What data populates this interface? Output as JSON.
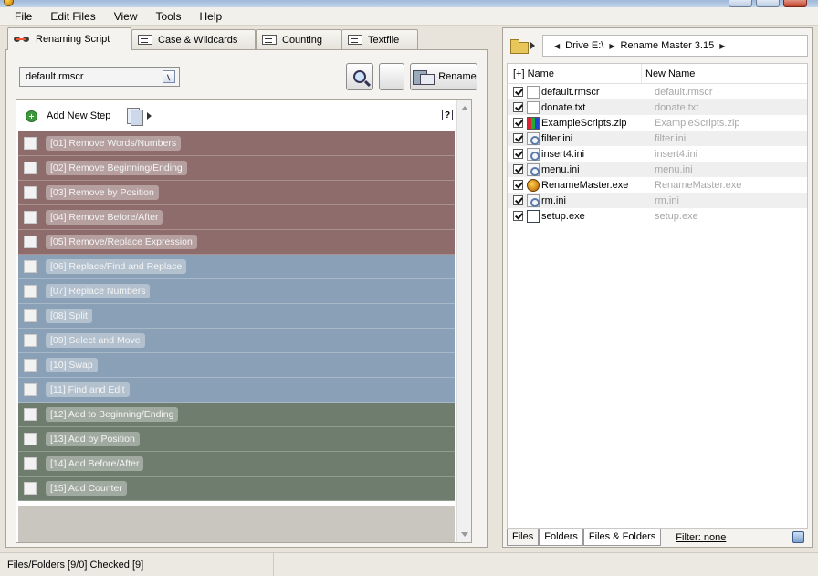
{
  "menu": [
    "File",
    "Edit Files",
    "View",
    "Tools",
    "Help"
  ],
  "tabs": [
    {
      "label": "Renaming Script",
      "icon": "glasses-icon",
      "active": true
    },
    {
      "label": "Case & Wildcards",
      "icon": "case-icon",
      "active": false
    },
    {
      "label": "Counting",
      "icon": "counting-icon",
      "active": false
    },
    {
      "label": "Textfile",
      "icon": "textfile-icon",
      "active": false
    }
  ],
  "script_select": {
    "value": "default.rmscr"
  },
  "toolbar": {
    "rename_label": "Rename"
  },
  "steps_header": {
    "add_label": "Add New Step",
    "help_label": "?"
  },
  "steps": [
    {
      "label": "[01]  Remove Words/Numbers",
      "group": "red"
    },
    {
      "label": "[02]  Remove Beginning/Ending",
      "group": "red"
    },
    {
      "label": "[03]  Remove by Position",
      "group": "red"
    },
    {
      "label": "[04]  Remove Before/After",
      "group": "red"
    },
    {
      "label": "[05]  Remove/Replace Expression",
      "group": "red"
    },
    {
      "label": "[06]  Replace/Find and Replace",
      "group": "blue"
    },
    {
      "label": "[07]  Replace Numbers",
      "group": "blue"
    },
    {
      "label": "[08]  Split",
      "group": "blue"
    },
    {
      "label": "[09]  Select and Move",
      "group": "blue"
    },
    {
      "label": "[10]  Swap",
      "group": "blue"
    },
    {
      "label": "[11]  Find and Edit",
      "group": "blue"
    },
    {
      "label": "[12]  Add to Beginning/Ending",
      "group": "green"
    },
    {
      "label": "[13]  Add by Position",
      "group": "green"
    },
    {
      "label": "[14]  Add Before/After",
      "group": "green"
    },
    {
      "label": "[15]  Add Counter",
      "group": "green"
    }
  ],
  "colors": {
    "red_group": "#8e6c6c",
    "blue_group": "#8aa0b6",
    "green_group": "#6e7d6e"
  },
  "address": {
    "crumbs": [
      "Drive E:\\",
      "Rename Master 3.15"
    ]
  },
  "file_list": {
    "col_name": "[+] Name",
    "col_new": "New Name",
    "files": [
      {
        "name": "default.rmscr",
        "new": "default.rmscr",
        "icon": "doc"
      },
      {
        "name": "donate.txt",
        "new": "donate.txt",
        "icon": "doc"
      },
      {
        "name": "ExampleScripts.zip",
        "new": "ExampleScripts.zip",
        "icon": "zip"
      },
      {
        "name": "filter.ini",
        "new": "filter.ini",
        "icon": "ini"
      },
      {
        "name": "insert4.ini",
        "new": "insert4.ini",
        "icon": "ini"
      },
      {
        "name": "menu.ini",
        "new": "menu.ini",
        "icon": "ini"
      },
      {
        "name": "RenameMaster.exe",
        "new": "RenameMaster.exe",
        "icon": "exe"
      },
      {
        "name": "rm.ini",
        "new": "rm.ini",
        "icon": "ini"
      },
      {
        "name": "setup.exe",
        "new": "setup.exe",
        "icon": "setup"
      }
    ]
  },
  "bottom_tabs": [
    "Files",
    "Folders",
    "Files & Folders"
  ],
  "filter_label": "Filter:  none",
  "status": {
    "text": "Files/Folders [9/0] Checked [9]"
  }
}
